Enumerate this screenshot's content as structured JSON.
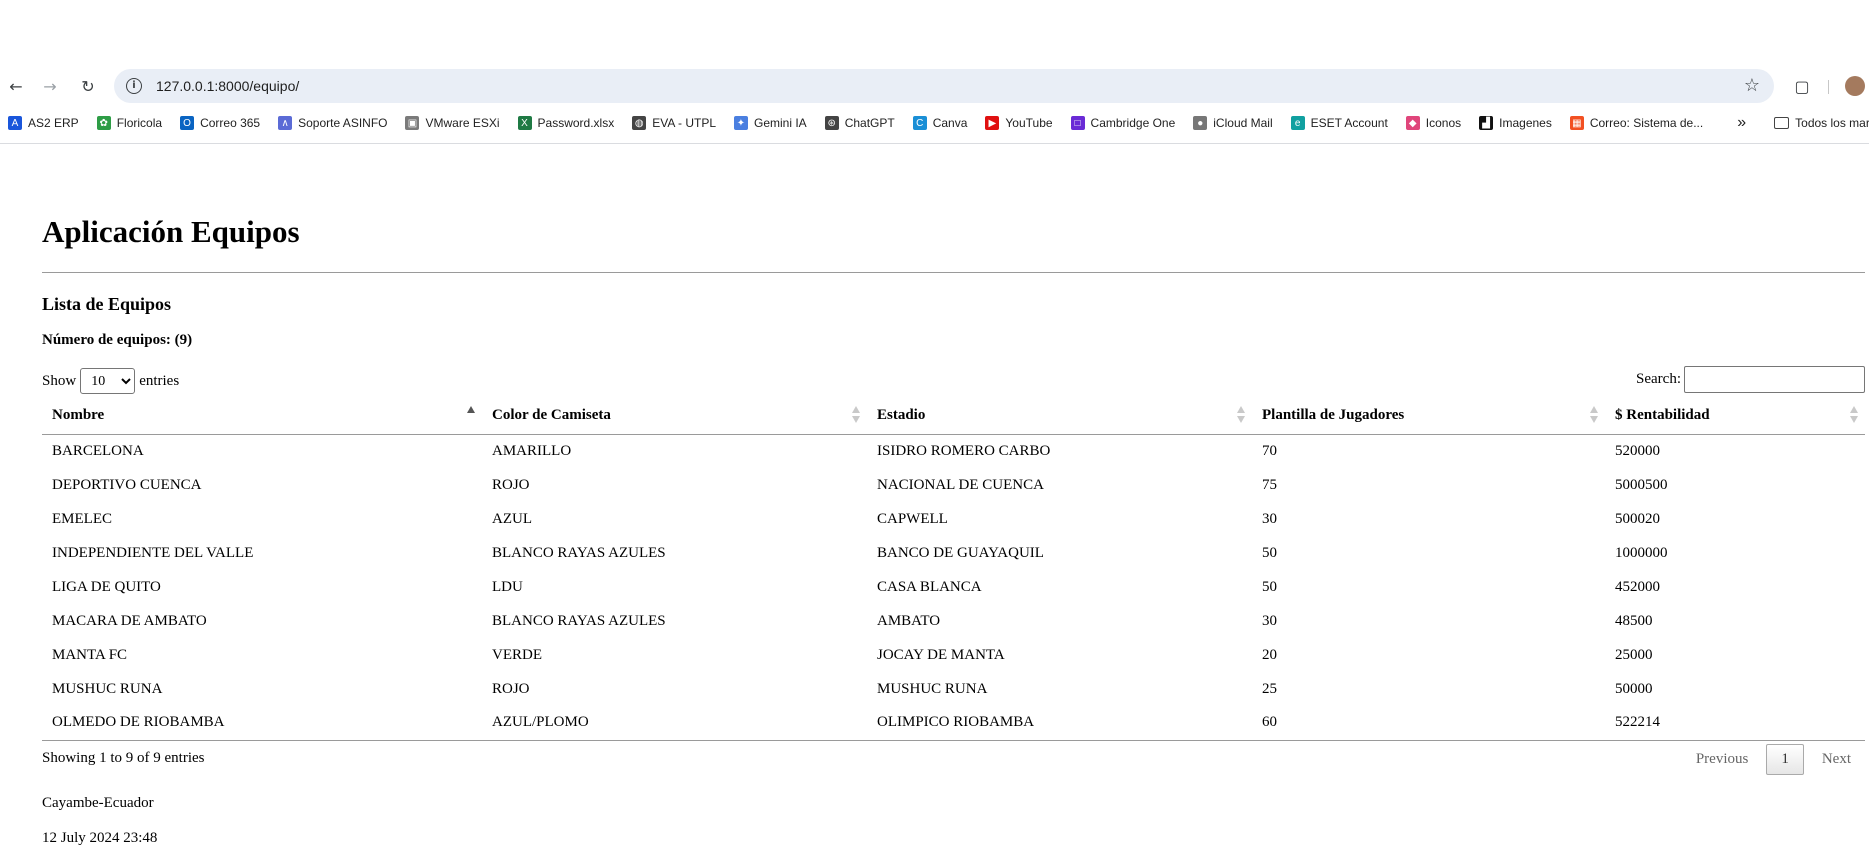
{
  "browser": {
    "url": "127.0.0.1:8000/equipo/",
    "bookmarks": [
      {
        "label": "AS2 ERP",
        "icon": "as2-icon",
        "color": "#1a56db"
      },
      {
        "label": "Floricola",
        "icon": "flower-icon",
        "color": "#2e9d46"
      },
      {
        "label": "Correo 365",
        "icon": "outlook-icon",
        "color": "#0a64c2"
      },
      {
        "label": "Soporte ASINFO",
        "icon": "asinfo-icon",
        "color": "#5b6bd6"
      },
      {
        "label": "VMware ESXi",
        "icon": "vmware-icon",
        "color": "#7a7a7a"
      },
      {
        "label": "Password.xlsx",
        "icon": "excel-icon",
        "color": "#1f7a44"
      },
      {
        "label": "EVA - UTPL",
        "icon": "globe-icon",
        "color": "#444444"
      },
      {
        "label": "Gemini IA",
        "icon": "gemini-icon",
        "color": "#4a7fe0"
      },
      {
        "label": "ChatGPT",
        "icon": "chatgpt-icon",
        "color": "#444444"
      },
      {
        "label": "Canva",
        "icon": "canva-icon",
        "color": "#1a8fd6"
      },
      {
        "label": "YouTube",
        "icon": "youtube-icon",
        "color": "#e01010"
      },
      {
        "label": "Cambridge One",
        "icon": "cambridge-icon",
        "color": "#6a2bd6"
      },
      {
        "label": "iCloud Mail",
        "icon": "apple-icon",
        "color": "#777777"
      },
      {
        "label": "ESET  Account",
        "icon": "eset-icon",
        "color": "#11a0a0"
      },
      {
        "label": "Iconos",
        "icon": "iconos-icon",
        "color": "#e0457b"
      },
      {
        "label": "Imagenes",
        "icon": "imagenes-icon",
        "color": "#111111"
      },
      {
        "label": "Correo: Sistema de...",
        "icon": "microsoft-icon",
        "color": "#f25022"
      }
    ],
    "bookmarks_folder": "Todos los marca"
  },
  "page": {
    "title": "Aplicación Equipos",
    "subtitle": "Lista de Equipos",
    "count_label": "Número de equipos: (9)",
    "show_label": "Show",
    "entries_label": "entries",
    "page_size": "10",
    "search_label": "Search:",
    "search_value": "",
    "table": {
      "columns": [
        "Nombre",
        "Color de Camiseta",
        "Estadio",
        "Plantilla de Jugadores",
        "$ Rentabilidad"
      ],
      "rows": [
        [
          "BARCELONA",
          "AMARILLO",
          "ISIDRO ROMERO CARBO",
          "70",
          "520000"
        ],
        [
          "DEPORTIVO CUENCA",
          "ROJO",
          "NACIONAL DE CUENCA",
          "75",
          "5000500"
        ],
        [
          "EMELEC",
          "AZUL",
          "CAPWELL",
          "30",
          "500020"
        ],
        [
          "INDEPENDIENTE DEL VALLE",
          "BLANCO RAYAS AZULES",
          "BANCO DE GUAYAQUIL",
          "50",
          "1000000"
        ],
        [
          "LIGA DE QUITO",
          "LDU",
          "CASA BLANCA",
          "50",
          "452000"
        ],
        [
          "MACARA DE AMBATO",
          "BLANCO RAYAS AZULES",
          "AMBATO",
          "30",
          "48500"
        ],
        [
          "MANTA FC",
          "VERDE",
          "JOCAY DE MANTA",
          "20",
          "25000"
        ],
        [
          "MUSHUC RUNA",
          "ROJO",
          "MUSHUC RUNA",
          "25",
          "50000"
        ],
        [
          "OLMEDO DE RIOBAMBA",
          "AZUL/PLOMO",
          "OLIMPICO RIOBAMBA",
          "60",
          "522214"
        ]
      ]
    },
    "info": "Showing 1 to 9 of 9 entries",
    "pager": {
      "previous": "Previous",
      "current": "1",
      "next": "Next"
    },
    "footer_location": "Cayambe-Ecuador",
    "footer_datetime": "12 July 2024 23:48"
  }
}
